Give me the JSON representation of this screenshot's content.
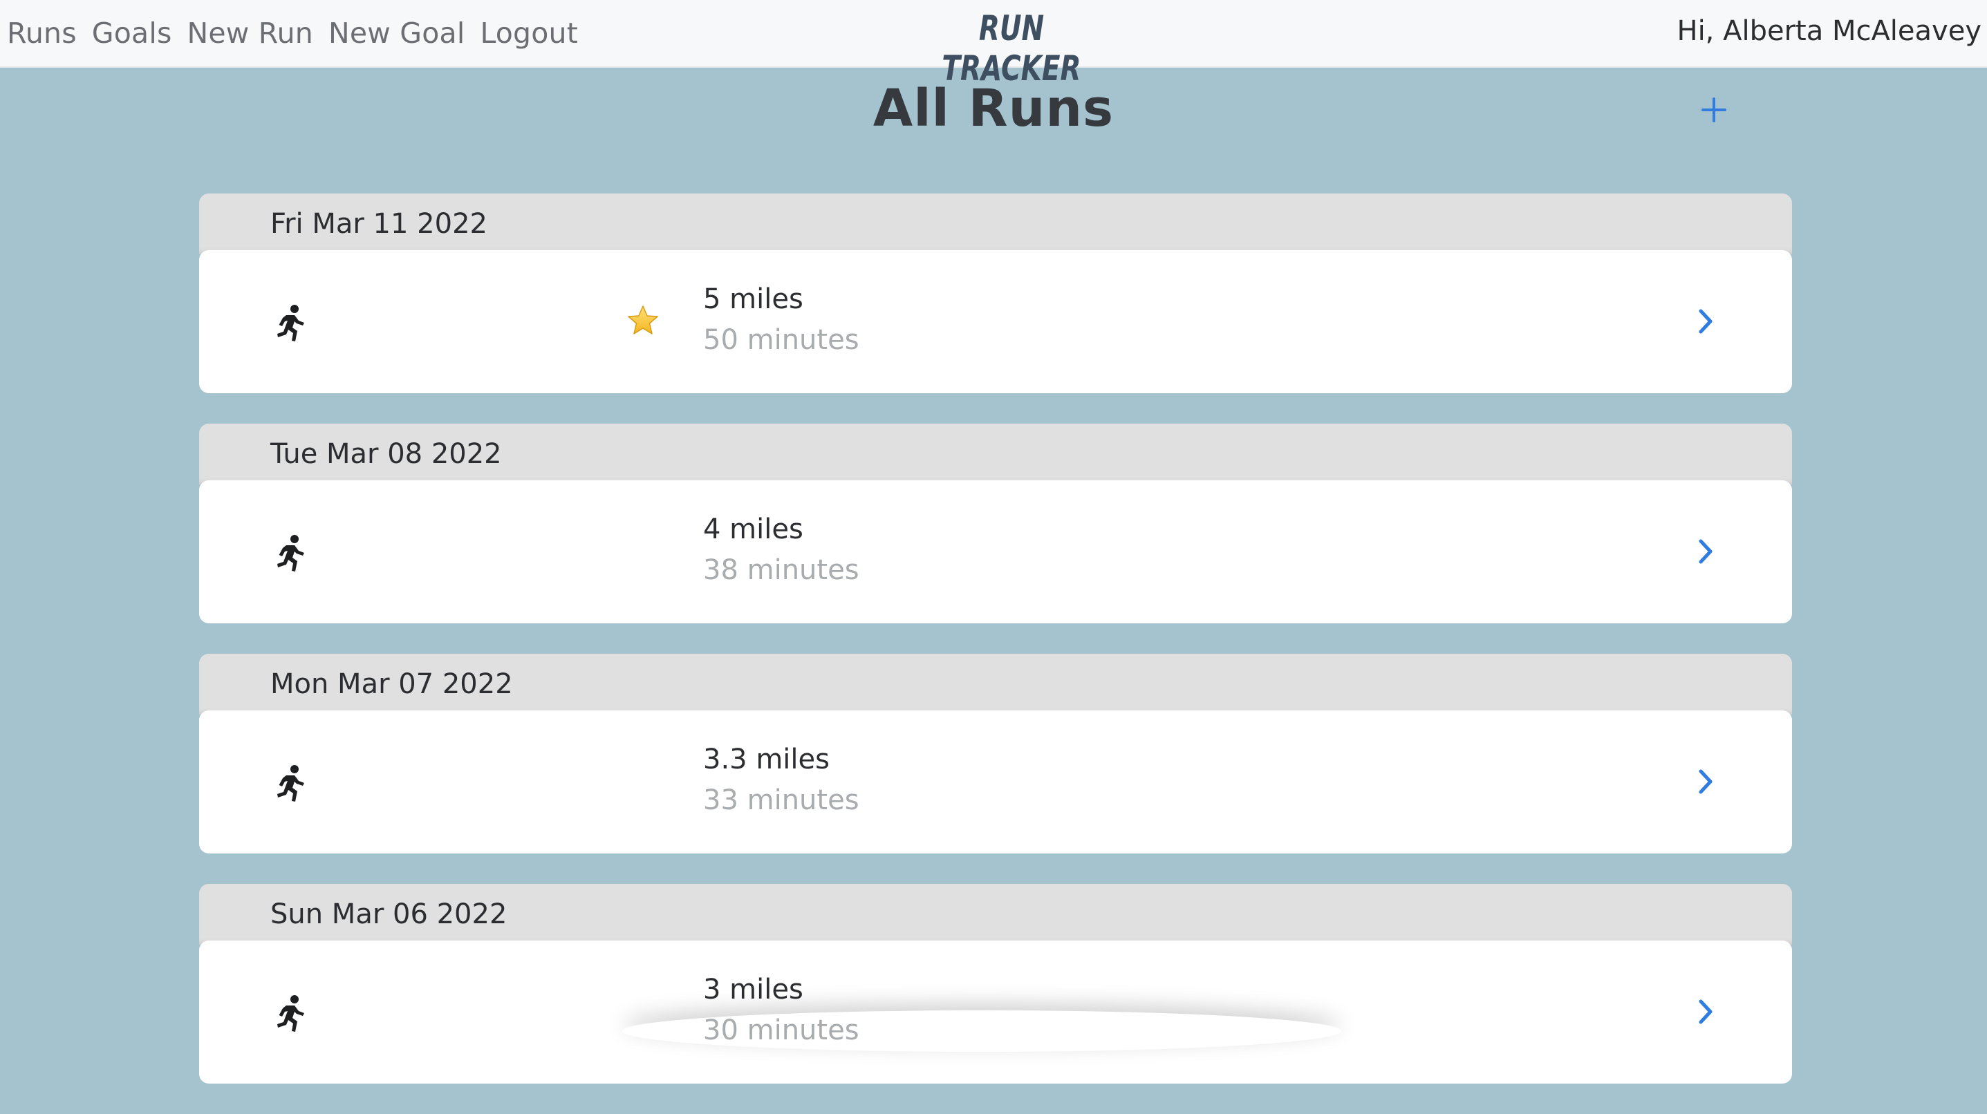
{
  "nav": {
    "links": [
      "Runs",
      "Goals",
      "New Run",
      "New Goal",
      "Logout"
    ],
    "brand": "RUN TRACKER",
    "greeting": "Hi, Alberta McAleavey"
  },
  "page": {
    "title": "All Runs",
    "add_icon": "plus-icon"
  },
  "colors": {
    "background": "#a5c3ce",
    "accent": "#2f7de1",
    "date_header": "#e0e0e0",
    "brand": "#3d4f61"
  },
  "runs": [
    {
      "date": "Fri Mar 11 2022",
      "distance": "5 miles",
      "duration": "50 minutes",
      "starred": true
    },
    {
      "date": "Tue Mar 08 2022",
      "distance": "4 miles",
      "duration": "38 minutes",
      "starred": false
    },
    {
      "date": "Mon Mar 07 2022",
      "distance": "3.3 miles",
      "duration": "33 minutes",
      "starred": false
    },
    {
      "date": "Sun Mar 06 2022",
      "distance": "3 miles",
      "duration": "30 minutes",
      "starred": false
    }
  ]
}
